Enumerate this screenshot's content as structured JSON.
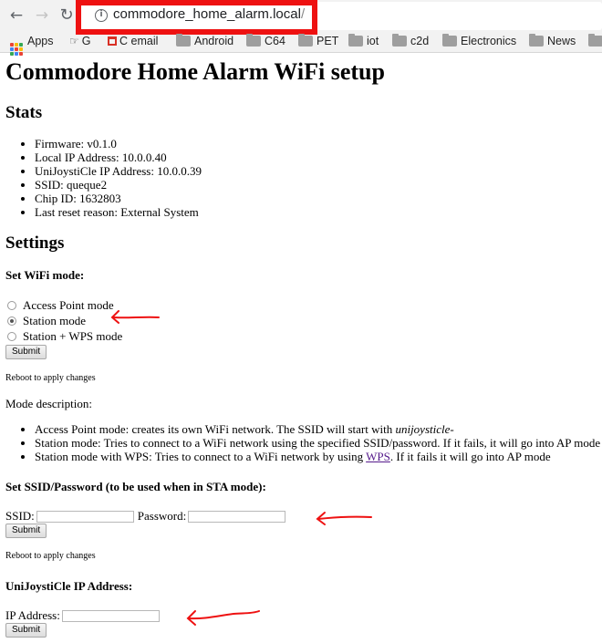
{
  "browser": {
    "url": "commodore_home_alarm.local",
    "url_trailing": "/",
    "bookmarks": [
      "Apps",
      "G",
      "C email",
      "Android",
      "C64",
      "PET",
      "iot",
      "c2d",
      "Electronics",
      "News"
    ]
  },
  "page": {
    "title": "Commodore Home Alarm WiFi setup",
    "stats_heading": "Stats",
    "stats": [
      "Firmware: v0.1.0",
      "Local IP Address: 10.0.0.40",
      "UniJoystiCle IP Address: 10.0.0.39",
      "SSID: queque2",
      "Chip ID: 1632803",
      "Last reset reason: External System"
    ],
    "settings_heading": "Settings",
    "wifi_mode": {
      "heading": "Set WiFi mode:",
      "options": [
        {
          "label": "Access Point mode",
          "checked": false
        },
        {
          "label": "Station mode",
          "checked": true
        },
        {
          "label": "Station + WPS mode",
          "checked": false
        }
      ],
      "submit": "Submit",
      "reboot_note": "Reboot to apply changes"
    },
    "mode_description": {
      "label": "Mode description:",
      "items": [
        {
          "prefix": "Access Point mode: creates its own WiFi network. The SSID will start with ",
          "emph": "unijoysticle-"
        },
        {
          "text": "Station mode: Tries to connect to a WiFi network using the specified SSID/password. If it fails, it will go into AP mode"
        },
        {
          "prefix": "Station mode with WPS: Tries to connect to a WiFi network by using ",
          "link": "WPS",
          "suffix": ". If it fails it will go into AP mode"
        }
      ]
    },
    "ssid_section": {
      "heading": "Set SSID/Password (to be used when in STA mode):",
      "ssid_label": "SSID:",
      "ssid_value": "",
      "password_label": "Password:",
      "password_value": "",
      "submit": "Submit",
      "reboot_note": "Reboot to apply changes"
    },
    "ip_section": {
      "heading": "UniJoystiCle IP Address:",
      "ip_label": "IP Address:",
      "ip_value": "",
      "submit": "Submit"
    }
  },
  "colors": {
    "annotation": "#ee1111",
    "link_visited": "#551a8b"
  }
}
